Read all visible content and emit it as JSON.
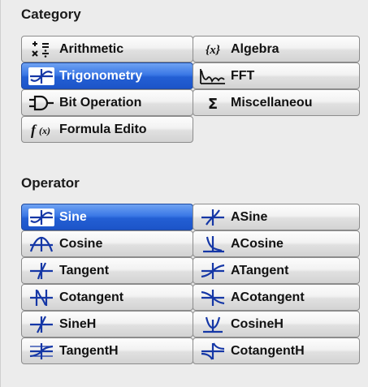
{
  "category": {
    "title": "Category",
    "items": [
      {
        "label": "Arithmetic",
        "icon": "arithmetic-icon"
      },
      {
        "label": "Algebra",
        "icon": "algebra-icon"
      },
      {
        "label": "Trigonometry",
        "icon": "trigonometry-icon",
        "selected": true
      },
      {
        "label": "FFT",
        "icon": "fft-icon"
      },
      {
        "label": "Bit Operation",
        "icon": "bit-operation-icon"
      },
      {
        "label": "Miscellaneou",
        "icon": "sigma-icon"
      },
      {
        "label": "Formula Edito",
        "icon": "formula-icon"
      }
    ]
  },
  "operator": {
    "title": "Operator",
    "items": [
      {
        "label": "Sine",
        "icon": "sine-icon",
        "selected": true
      },
      {
        "label": "ASine",
        "icon": "asine-icon"
      },
      {
        "label": "Cosine",
        "icon": "cosine-icon"
      },
      {
        "label": "ACosine",
        "icon": "acosine-icon"
      },
      {
        "label": "Tangent",
        "icon": "tangent-icon"
      },
      {
        "label": "ATangent",
        "icon": "atangent-icon"
      },
      {
        "label": "Cotangent",
        "icon": "cotangent-icon"
      },
      {
        "label": "ACotangent",
        "icon": "acotangent-icon"
      },
      {
        "label": "SineH",
        "icon": "sineh-icon"
      },
      {
        "label": "CosineH",
        "icon": "cosineh-icon"
      },
      {
        "label": "TangentH",
        "icon": "tangenth-icon"
      },
      {
        "label": "CotangentH",
        "icon": "cotangenth-icon"
      }
    ]
  },
  "colors": {
    "selected": "#2a66db",
    "wave": "#1537a6",
    "panel": "#ececec"
  }
}
